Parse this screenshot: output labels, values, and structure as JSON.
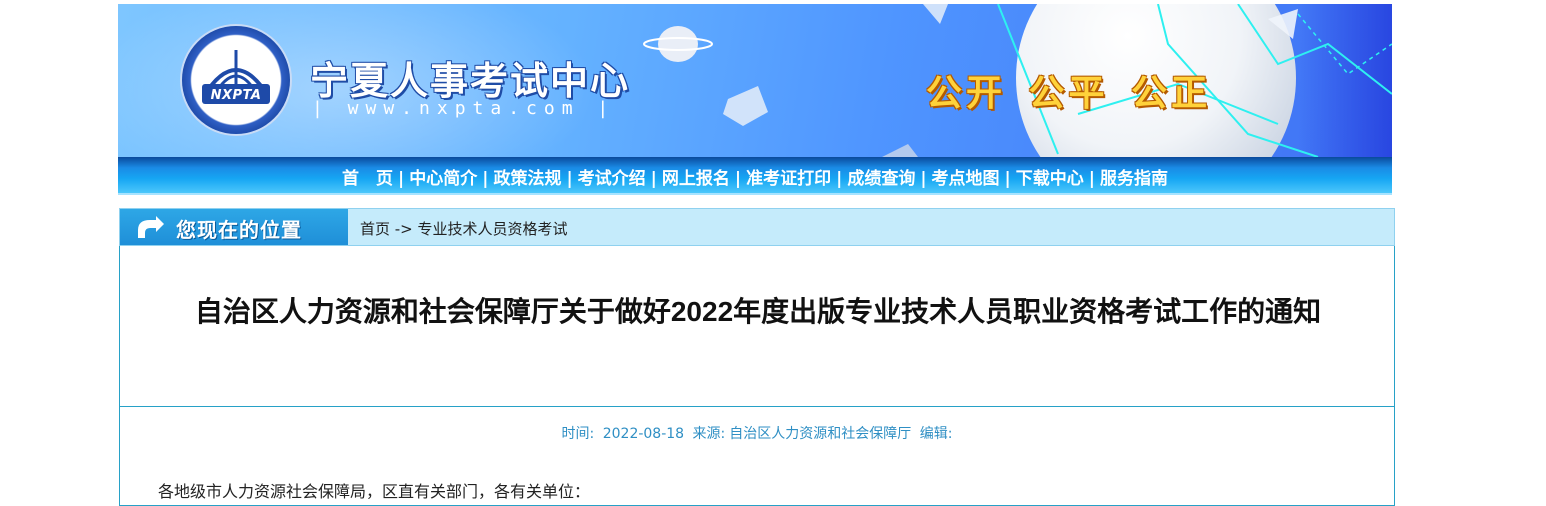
{
  "header": {
    "logo_text": "NXPTA",
    "site_title": "宁夏人事考试中心",
    "site_url": "| www.nxpta.com |",
    "slogan": "公开 公平 公正"
  },
  "nav": {
    "items": [
      {
        "label": "首　页"
      },
      {
        "label": "中心简介"
      },
      {
        "label": "政策法规"
      },
      {
        "label": "考试介绍"
      },
      {
        "label": "网上报名"
      },
      {
        "label": "准考证打印"
      },
      {
        "label": "成绩查询"
      },
      {
        "label": "考点地图"
      },
      {
        "label": "下载中心"
      },
      {
        "label": "服务指南"
      }
    ],
    "separator": "|"
  },
  "location": {
    "label": "您现在的位置",
    "breadcrumb": "首页 -> 专业技术人员资格考试"
  },
  "article": {
    "title": "自治区人力资源和社会保障厅关于做好2022年度出版专业技术人员职业资格考试工作的通知",
    "meta": {
      "time_label": "时间:",
      "time_value": "2022-08-18",
      "source_label": "来源:",
      "source_value": "自治区人力资源和社会保障厅",
      "editor_label": "编辑:"
    },
    "first_line": "各地级市人力资源社会保障局，区直有关部门，各有关单位："
  },
  "colors": {
    "nav_text": "#ffffff",
    "meta_text": "#2f8fc4",
    "border": "#27a1c7",
    "slogan": "#ffd23a"
  }
}
